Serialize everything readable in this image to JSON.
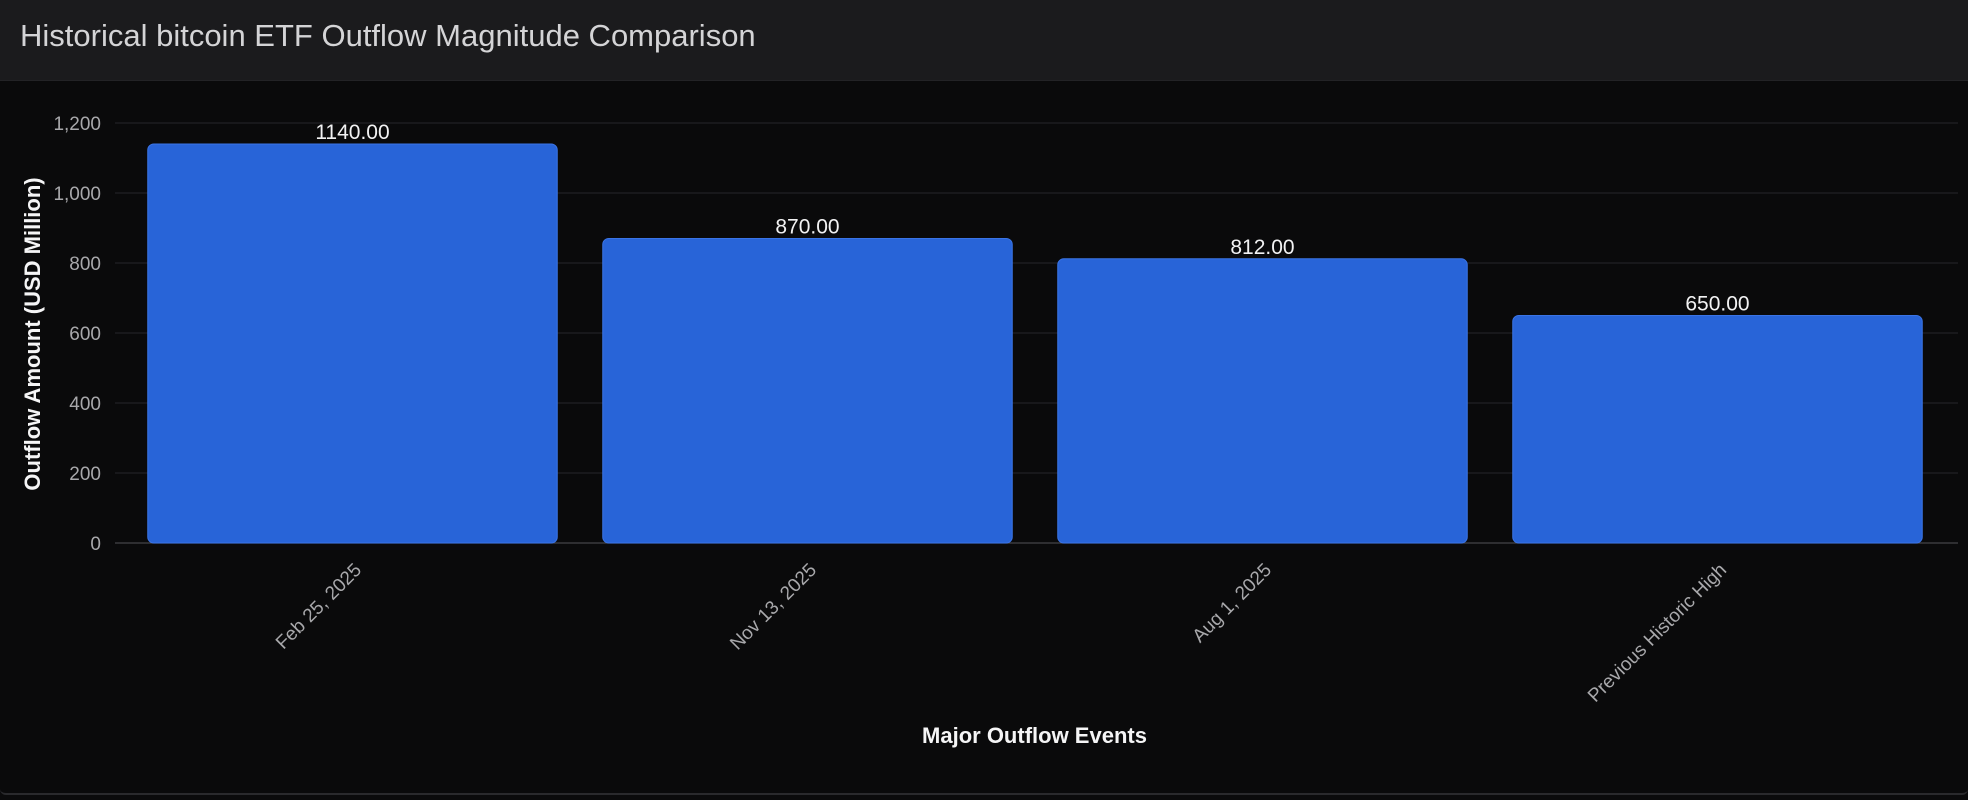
{
  "header": {
    "title": "Historical bitcoin ETF Outflow Magnitude Comparison"
  },
  "colors": {
    "bar": "#2864d8",
    "background": "#0a0a0b",
    "header": "#1b1b1d"
  },
  "chart_data": {
    "type": "bar",
    "title": "Historical bitcoin ETF Outflow Magnitude Comparison",
    "xlabel": "Major Outflow Events",
    "ylabel": "Outflow Amount (USD Million)",
    "categories": [
      "Feb 25, 2025",
      "Nov 13, 2025",
      "Aug 1, 2025",
      "Previous Historic High"
    ],
    "values": [
      1140,
      870,
      812,
      650
    ],
    "value_labels": [
      "1140.00",
      "870.00",
      "812.00",
      "650.00"
    ],
    "ylim": [
      0,
      1200
    ],
    "yticks": [
      0,
      200,
      400,
      600,
      800,
      1000,
      1200
    ],
    "ytick_labels": [
      "0",
      "200",
      "400",
      "600",
      "800",
      "1,000",
      "1,200"
    ],
    "grid": true,
    "legend": "none"
  }
}
